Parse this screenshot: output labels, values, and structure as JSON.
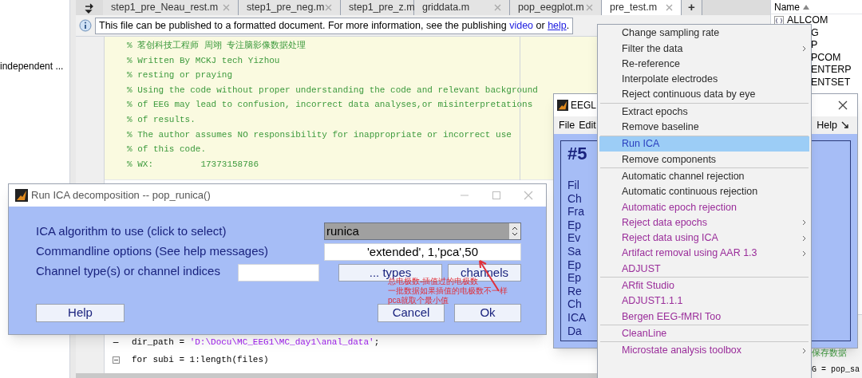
{
  "left_panel": {
    "item": "independent ..."
  },
  "editor": {
    "tabs": [
      {
        "label": "step1_pre_Neau_rest.m",
        "selected": false
      },
      {
        "label": "step1_pre_neg.m",
        "selected": false
      },
      {
        "label": "step1_pre_z.m",
        "selected": false
      },
      {
        "label": "griddata.m",
        "selected": false
      },
      {
        "label": "pop_eegplot.m",
        "selected": false
      },
      {
        "label": "pre_test.m",
        "selected": true
      }
    ],
    "new_tab": "+",
    "info": {
      "before": "This file can be published to a formatted document. For more information, see the publishing",
      "link_1": "video",
      "middle": "or",
      "link_2": "help",
      "after": "."
    },
    "comment_lines": [
      "% 茗创科技工程师 周翊 专注脑影像数据处理",
      "% Written By MCKJ tech Yizhou",
      "% resting or praying",
      "% Using the code without proper understanding the code and relevant background",
      "% of EEG may lead to confusion, incorrect data analyses,or misinterpretations",
      "% of results.",
      "% The author assumes NO responsibility for inappropriate or incorrect use",
      "% of this code.",
      "% WX:         17373158786"
    ],
    "code_lines": [
      {
        "marker": "–",
        "fold": false,
        "parts": [
          {
            "kind": "code",
            "text": "dir_path = "
          },
          {
            "kind": "string",
            "text": "'D:\\Docu\\MC_EEG1\\MC_day1\\anal_data'"
          },
          {
            "kind": "code",
            "text": ";"
          }
        ]
      },
      {
        "fold": true,
        "parts": [
          {
            "kind": "code",
            "text": "for subi = 1:length(files)"
          }
        ]
      }
    ]
  },
  "workspace": {
    "header": "Name",
    "items": [
      {
        "name": "ALLCOM",
        "icon": true
      },
      {
        "name": "G",
        "icon": false
      },
      {
        "name": "P",
        "icon": false
      },
      {
        "name": "PCOM",
        "icon": false
      },
      {
        "name": "ENTERP",
        "icon": false
      },
      {
        "name": "ENTSET",
        "icon": false
      }
    ]
  },
  "lower_right": {
    "comment": "保存数据",
    "code": "G = pop_sa"
  },
  "eeglab": {
    "title": "EEGL",
    "menus_left": [
      "File",
      "Edit"
    ],
    "menus_right": [
      "Help"
    ],
    "dataset": "#5",
    "labels": [
      "Fil",
      "Ch",
      "Fra",
      "Ep",
      "Ev",
      "Sa",
      "Ep",
      "Ep",
      "Re",
      "Ch",
      "ICA",
      "Da"
    ]
  },
  "dialog": {
    "title": "Run ICA decomposition -- pop_runica()",
    "rows": [
      "ICA algorithm to use (click to select)",
      "Commandline options (See help messages)",
      "Channel type(s) or channel indices"
    ],
    "algorithm": "runica",
    "options": "'extended', 1,'pca',50",
    "types_button": "... types",
    "channels_button": "channels",
    "buttons": [
      "Help",
      "Cancel",
      "Ok"
    ],
    "annotation": [
      "总电极数-插值过的电极数",
      "一批数据如果插值的电极数不一样",
      "pca就取个最小值"
    ]
  },
  "menu": {
    "groups": [
      [
        {
          "label": "Change sampling rate",
          "kind": "builtin",
          "submenu": false,
          "selected": false
        },
        {
          "label": "Filter the data",
          "kind": "builtin",
          "submenu": true,
          "selected": false
        },
        {
          "label": "Re-reference",
          "kind": "builtin",
          "submenu": false,
          "selected": false
        },
        {
          "label": "Interpolate electrodes",
          "kind": "builtin",
          "submenu": false,
          "selected": false
        },
        {
          "label": "Reject continuous data by eye",
          "kind": "builtin",
          "submenu": false,
          "selected": false
        }
      ],
      [
        {
          "label": "Extract epochs",
          "kind": "builtin",
          "submenu": false,
          "selected": false
        },
        {
          "label": "Remove baseline",
          "kind": "builtin",
          "submenu": false,
          "selected": false
        }
      ],
      [
        {
          "label": "Run ICA",
          "kind": "builtin",
          "submenu": false,
          "selected": true
        },
        {
          "label": "Remove components",
          "kind": "builtin",
          "submenu": false,
          "selected": false
        }
      ],
      [
        {
          "label": "Automatic channel rejection",
          "kind": "builtin",
          "submenu": false,
          "selected": false
        },
        {
          "label": "Automatic continuous rejection",
          "kind": "builtin",
          "submenu": false,
          "selected": false
        },
        {
          "label": "Automatic epoch rejection",
          "kind": "plugin",
          "submenu": false,
          "selected": false
        },
        {
          "label": "Reject data epochs",
          "kind": "plugin",
          "submenu": true,
          "selected": false
        },
        {
          "label": "Reject data using ICA",
          "kind": "plugin",
          "submenu": true,
          "selected": false
        },
        {
          "label": "Artifact removal using AAR 1.3",
          "kind": "plugin",
          "submenu": true,
          "selected": false
        },
        {
          "label": "ADJUST",
          "kind": "plugin",
          "submenu": false,
          "selected": false
        }
      ],
      [
        {
          "label": "ARfit Studio",
          "kind": "plugin",
          "submenu": false,
          "selected": false
        },
        {
          "label": "ADJUST1.1.1",
          "kind": "plugin",
          "submenu": false,
          "selected": false
        },
        {
          "label": "Bergen EEG-fMRI Too",
          "kind": "plugin",
          "submenu": false,
          "selected": false
        }
      ],
      [
        {
          "label": "CleanLine",
          "kind": "plugin",
          "submenu": false,
          "selected": false
        }
      ],
      [
        {
          "label": "Microstate analysis toolbox",
          "kind": "plugin",
          "submenu": true,
          "selected": false
        }
      ]
    ]
  }
}
